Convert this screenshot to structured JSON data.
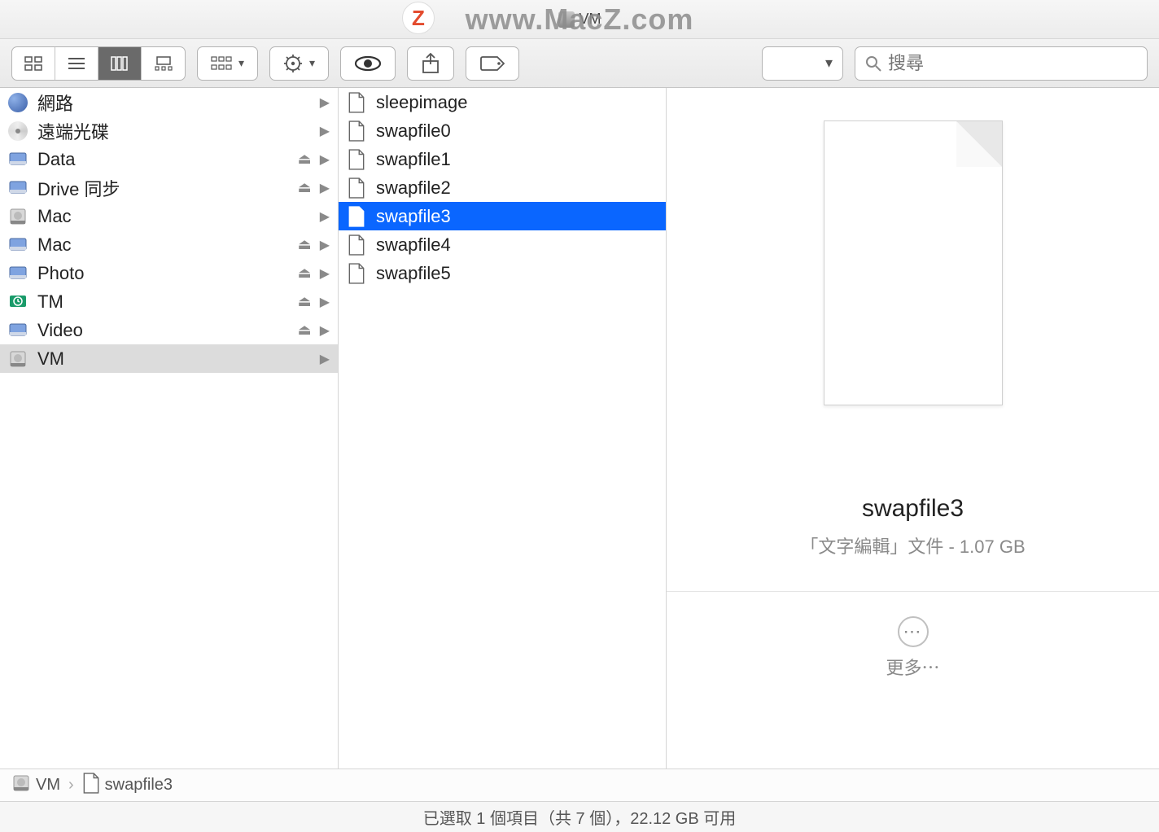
{
  "window": {
    "title": "VM",
    "watermark": "www.MacZ.com",
    "watermark_initial": "Z"
  },
  "toolbar": {
    "search_placeholder": "搜尋"
  },
  "sidebar": {
    "items": [
      {
        "label": "網路",
        "icon": "globe",
        "eject": false,
        "arrow": true,
        "selected": false
      },
      {
        "label": "遠端光碟",
        "icon": "cd",
        "eject": false,
        "arrow": true,
        "selected": false
      },
      {
        "label": "Data",
        "icon": "drive",
        "eject": true,
        "arrow": true,
        "selected": false
      },
      {
        "label": "Drive 同步",
        "icon": "drive",
        "eject": true,
        "arrow": true,
        "selected": false
      },
      {
        "label": "Mac",
        "icon": "hdd",
        "eject": false,
        "arrow": true,
        "selected": false
      },
      {
        "label": "Mac",
        "icon": "folder-drive",
        "eject": true,
        "arrow": true,
        "selected": false
      },
      {
        "label": "Photo",
        "icon": "drive",
        "eject": true,
        "arrow": true,
        "selected": false
      },
      {
        "label": "TM",
        "icon": "tm",
        "eject": true,
        "arrow": true,
        "selected": false
      },
      {
        "label": "Video",
        "icon": "drive",
        "eject": true,
        "arrow": true,
        "selected": false
      },
      {
        "label": "VM",
        "icon": "hdd",
        "eject": false,
        "arrow": true,
        "selected": true
      }
    ]
  },
  "files": {
    "items": [
      {
        "label": "sleepimage",
        "selected": false
      },
      {
        "label": "swapfile0",
        "selected": false
      },
      {
        "label": "swapfile1",
        "selected": false
      },
      {
        "label": "swapfile2",
        "selected": false
      },
      {
        "label": "swapfile3",
        "selected": true
      },
      {
        "label": "swapfile4",
        "selected": false
      },
      {
        "label": "swapfile5",
        "selected": false
      }
    ]
  },
  "preview": {
    "name": "swapfile3",
    "meta": "「文字編輯」文件 - 1.07 GB",
    "more_label": "更多⋯"
  },
  "pathbar": {
    "segments": [
      {
        "label": "VM",
        "icon": "hdd"
      },
      {
        "label": "swapfile3",
        "icon": "file"
      }
    ]
  },
  "statusbar": {
    "text": "已選取 1 個項目（共 7 個），22.12 GB 可用"
  }
}
